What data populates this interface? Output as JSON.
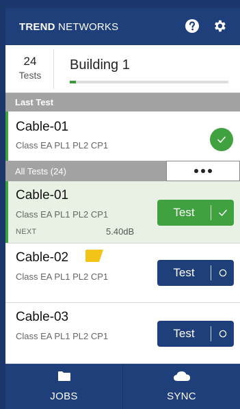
{
  "header": {
    "brand_bold": "TREND",
    "brand_rest": " NETWORKS",
    "help_icon": "question-circle-icon",
    "settings_icon": "gear-icon"
  },
  "summary": {
    "count": "24",
    "count_label": "Tests",
    "building": "Building 1",
    "progress_fraction": 0.04
  },
  "last_test": {
    "section_label": "Last Test",
    "name": "Cable-01",
    "class": "Class EA PL1 PL2 CP1",
    "status_icon": "check-icon"
  },
  "all_tests": {
    "label": "All Tests (24)",
    "more_icon": "more-horizontal-icon"
  },
  "tests": [
    {
      "name": "Cable-01",
      "class": "Class EA PL1 PL2 CP1",
      "metric_label": "NEXT",
      "metric_value": "5.40dB",
      "button": "Test",
      "state": "pass"
    },
    {
      "name": "Cable-02",
      "class": "Class EA PL1 PL2 CP1",
      "button": "Test",
      "state": "untested",
      "tag_icon": "tag-icon"
    },
    {
      "name": "Cable-03",
      "class": "Class EA PL1 PL2 CP1",
      "button": "Test",
      "state": "untested"
    }
  ],
  "nav": {
    "jobs": "JOBS",
    "sync": "SYNC",
    "jobs_icon": "folder-icon",
    "sync_icon": "cloud-icon"
  },
  "colors": {
    "navy": "#1e3f7a",
    "green": "#3fa13f",
    "grey_bar": "#a3a3a3",
    "tag_yellow": "#f2c418"
  }
}
